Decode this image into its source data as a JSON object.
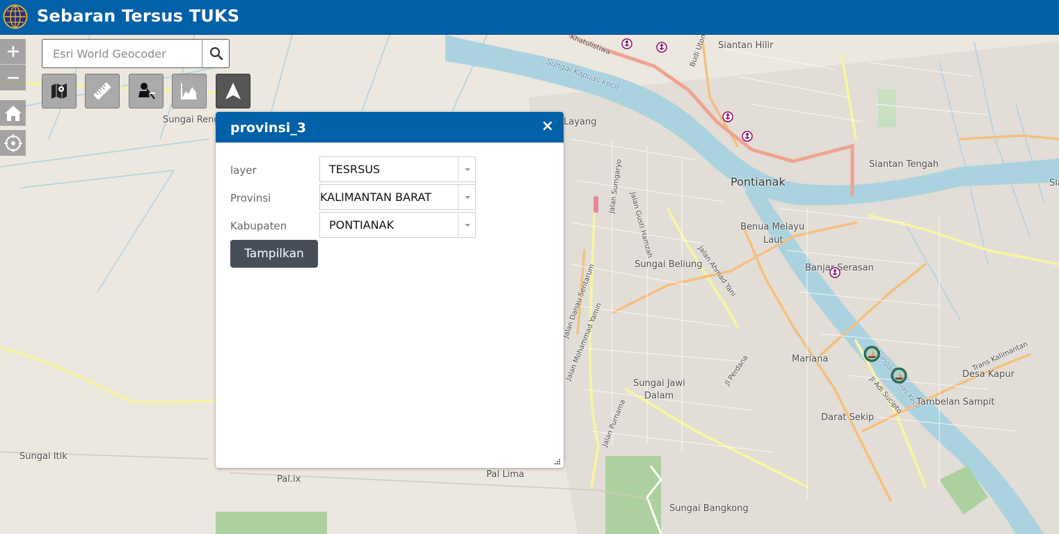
{
  "header": {
    "title": "Sebaran Tersus TUKS",
    "logo_icon": "globe-logo-icon"
  },
  "map": {
    "labels": [
      {
        "id": "siantan-hilir",
        "text": "Siantan Hilir"
      },
      {
        "id": "sungai-kapuas-kecil",
        "text": "Sungai Kapuas kecil"
      },
      {
        "id": "sungai-rengas",
        "text": "Sungai Reng"
      },
      {
        "id": "layang",
        "text": "Layang"
      },
      {
        "id": "siantan-tengah",
        "text": "Siantan Tengah"
      },
      {
        "id": "pontianak",
        "text": "Pontianak"
      },
      {
        "id": "benua-melayu-laut-1",
        "text": "Benua Melayu"
      },
      {
        "id": "benua-melayu-laut-2",
        "text": "Laut"
      },
      {
        "id": "banjar-serasan",
        "text": "Banjar Serasan"
      },
      {
        "id": "sungai-beliung",
        "text": "Sungai Beliung"
      },
      {
        "id": "mariana",
        "text": "Mariana"
      },
      {
        "id": "desa-kapur",
        "text": "Desa Kapur"
      },
      {
        "id": "tambelan-sampit",
        "text": "Tambelan Sampit"
      },
      {
        "id": "sungai-jawi-dalam-1",
        "text": "Sungai Jawi"
      },
      {
        "id": "sungai-jawi-dalam-2",
        "text": "Dalam"
      },
      {
        "id": "darat-sekip",
        "text": "Darat Sekip"
      },
      {
        "id": "sungai-itik",
        "text": "Sungai Itik"
      },
      {
        "id": "pal-ix",
        "text": "Pal.ix"
      },
      {
        "id": "pal-lima",
        "text": "Pal Lima"
      },
      {
        "id": "sungai-bangkong",
        "text": "Sungai Bangkong"
      },
      {
        "id": "edge-sia",
        "text": "Sia"
      }
    ],
    "street_labels": [
      {
        "id": "khatulistiwa",
        "text": "Khatulistiwa"
      },
      {
        "id": "budi-utomo",
        "text": "Budi Utomo"
      },
      {
        "id": "jalan-gusti-hamzah",
        "text": "Jalan Gusti Hamzah"
      },
      {
        "id": "jalan-sungai-raya",
        "text": "Jalan Sumgaryo"
      },
      {
        "id": "jalan-ahmad-yani",
        "text": "Jalan Ahmad Yani"
      },
      {
        "id": "jalan-danau-sentarum",
        "text": "Jalan Danau Sentarum"
      },
      {
        "id": "jalan-mohammad-yamin",
        "text": "Jalan Mohammad Yamin"
      },
      {
        "id": "jl-perdana",
        "text": "Jl Perdana"
      },
      {
        "id": "jalan-purnama",
        "text": "Jalan Purnama"
      },
      {
        "id": "jl-adi-sucipto",
        "text": "Jl Adi Sucipto"
      },
      {
        "id": "trans-kalimantan",
        "text": "Trans Kalimantan"
      },
      {
        "id": "sungai-kapuas-kecil-2",
        "text": "Sungai Kapuas Kecil"
      }
    ]
  },
  "controls": {
    "zoom_in_icon": "plus-icon",
    "zoom_out_icon": "minus-icon",
    "home_icon": "home-icon",
    "locate_icon": "locate-icon"
  },
  "search": {
    "placeholder": "Esri World Geocoder",
    "value": "",
    "button_icon": "search-icon"
  },
  "toolbar": {
    "tools": [
      {
        "name": "basemap-tool",
        "icon": "map-icon"
      },
      {
        "name": "measure-tool",
        "icon": "ruler-icon"
      },
      {
        "name": "query-tool",
        "icon": "filter-tool-icon"
      },
      {
        "name": "elevation-tool",
        "icon": "elevation-chart-icon"
      },
      {
        "name": "navigation-tool",
        "icon": "navigation-arrow-icon"
      }
    ]
  },
  "dialog": {
    "title": "provinsi_3",
    "close_symbol": "×",
    "fields": {
      "layer": {
        "label": "layer",
        "value": "TESRSUS"
      },
      "provinsi": {
        "label": "Provinsi",
        "value": "KALIMANTAN BARAT"
      },
      "kabupaten": {
        "label": "Kabupaten",
        "value": "PONTIANAK"
      }
    },
    "submit_label": "Tampilkan"
  },
  "colors": {
    "header_bg": "#0060a8",
    "dialog_header_bg": "#0060a8",
    "submit_bg": "#464e5a",
    "river": "#aad3df",
    "marker_purple": "#8b0a6e",
    "marker_green": "#2f7a5a"
  }
}
